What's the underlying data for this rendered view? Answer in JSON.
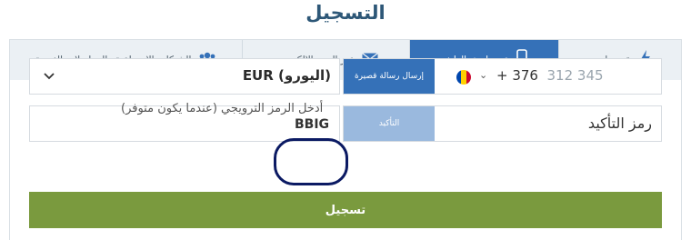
{
  "page": {
    "title": "التسجيل"
  },
  "tabs": [
    {
      "label": "نقره واحده",
      "icon": "lightning-icon",
      "active": false
    },
    {
      "label": "عن طريق الهاتف",
      "icon": "mobile-phone-icon",
      "active": true
    },
    {
      "label": "عبر البريد الالكتروني",
      "icon": "envelope-icon",
      "active": false
    },
    {
      "label": "الشبكات الاجتماعية والمراسلات الفورية",
      "icon": "people-group-icon",
      "active": false
    }
  ],
  "phone": {
    "country_flag": "moldova-flag-icon",
    "prefix": "+ 376",
    "placeholder": "312 345",
    "sms_button": "إرسال رسالة قصيرة"
  },
  "currency": {
    "value": "EUR (اليورو)"
  },
  "confirmation": {
    "label": "رمز التأكيد",
    "button": "التأكيد"
  },
  "promo": {
    "label": "أدخل الرمز الترويجي (عندما يكون متوفر)",
    "value": "BBIG"
  },
  "register": {
    "label": "تسجيل"
  },
  "colors": {
    "accent": "#3571b8",
    "register": "#7a9a3e",
    "title": "#2d5777",
    "annotation": "#0b1a63"
  }
}
